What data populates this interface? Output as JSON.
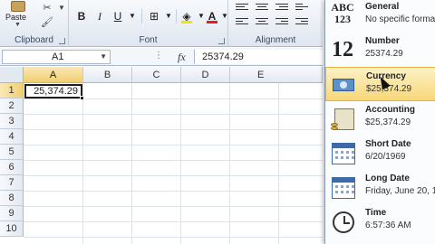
{
  "ribbon": {
    "clipboard": {
      "label": "Clipboard",
      "paste_label": "Paste"
    },
    "font": {
      "label": "Font",
      "bold": "B",
      "italic": "I",
      "underline": "U",
      "font_color": "A"
    },
    "alignment": {
      "label": "Alignment"
    }
  },
  "formula_bar": {
    "name_box": "A1",
    "fx": "fx",
    "value": "25374.29"
  },
  "grid": {
    "columns": [
      "A",
      "B",
      "C",
      "D",
      "E"
    ],
    "rows": [
      "1",
      "2",
      "3",
      "4",
      "5",
      "6",
      "7",
      "8",
      "9",
      "10"
    ],
    "cell_a1": "25,374.29",
    "selected_cell": "A1"
  },
  "number_format_menu": {
    "items": [
      {
        "icon": "abc-123-icon",
        "title": "General",
        "subtitle": "No specific forma"
      },
      {
        "icon": "number-12-icon",
        "title": "Number",
        "subtitle": "25374.29"
      },
      {
        "icon": "currency-icon",
        "title": "Currency",
        "subtitle": "$25,374.29"
      },
      {
        "icon": "accounting-icon",
        "title": "Accounting",
        "subtitle": "$25,374.29"
      },
      {
        "icon": "calendar-icon",
        "title": "Short Date",
        "subtitle": "6/20/1969"
      },
      {
        "icon": "calendar-icon",
        "title": "Long Date",
        "subtitle": "Friday, June 20, 1"
      },
      {
        "icon": "clock-icon",
        "title": "Time",
        "subtitle": "6:57:36 AM"
      }
    ],
    "hovered": "Currency"
  },
  "colors": {
    "selection_header": "#f1cf72",
    "hover_item": "#f8d777",
    "accent_border": "#a9b8cc"
  }
}
